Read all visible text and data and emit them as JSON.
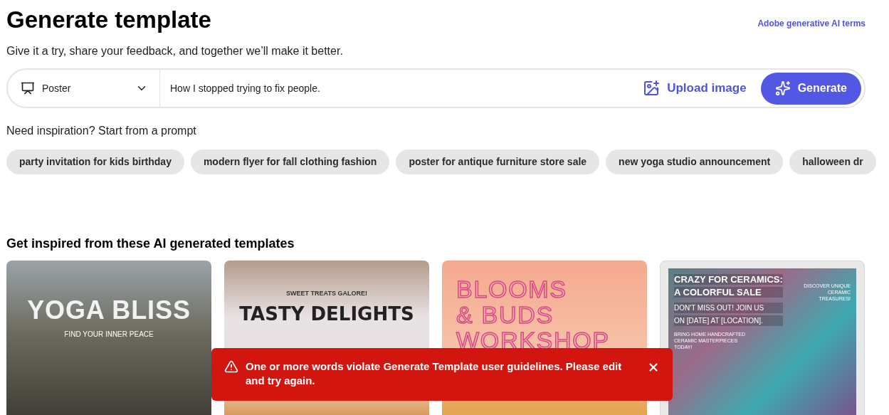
{
  "header": {
    "title": "Generate template",
    "subtitle": "Give it a try, share your feedback, and together we’ll make it better.",
    "terms_link": "Adobe generative AI terms"
  },
  "prompt_bar": {
    "format": "Poster",
    "value": "How I stopped trying to fix people.",
    "upload": "Upload image",
    "generate": "Generate"
  },
  "inspiration": {
    "heading": "Need inspiration? Start from a prompt",
    "chips": [
      "party invitation for kids birthday",
      "modern flyer for fall clothing fashion",
      "poster for antique furniture store sale",
      "new yoga studio announcement",
      "halloween dr"
    ]
  },
  "templates": {
    "heading": "Get inspired from these AI generated templates",
    "cards": [
      {
        "kind": "yoga",
        "texts": [
          "YOGA BLISS",
          "FIND YOUR INNER PEACE"
        ]
      },
      {
        "kind": "food",
        "texts": [
          "SWEET TREATS GALORE!",
          "TASTY DELIGHTS"
        ]
      },
      {
        "kind": "flowers",
        "texts": [
          "BLOOMS",
          "& BUDS",
          "WORKSHOP"
        ]
      },
      {
        "kind": "ceramics",
        "texts": [
          "CRAZY FOR CERAMICS:",
          "A COLORFUL SALE",
          "DON'T MISS OUT! JOIN US",
          "ON [DATE] AT [LOCATION].",
          "BRING HOME HANDCRAFTED CERAMIC MASTERPIECES TODAY!",
          "DISCOVER UNIQUE CERAMIC TREASURES!"
        ]
      }
    ]
  },
  "toast": {
    "kind": "error",
    "message": "One or more words violate Generate Template user guidelines. Please edit and try again."
  }
}
